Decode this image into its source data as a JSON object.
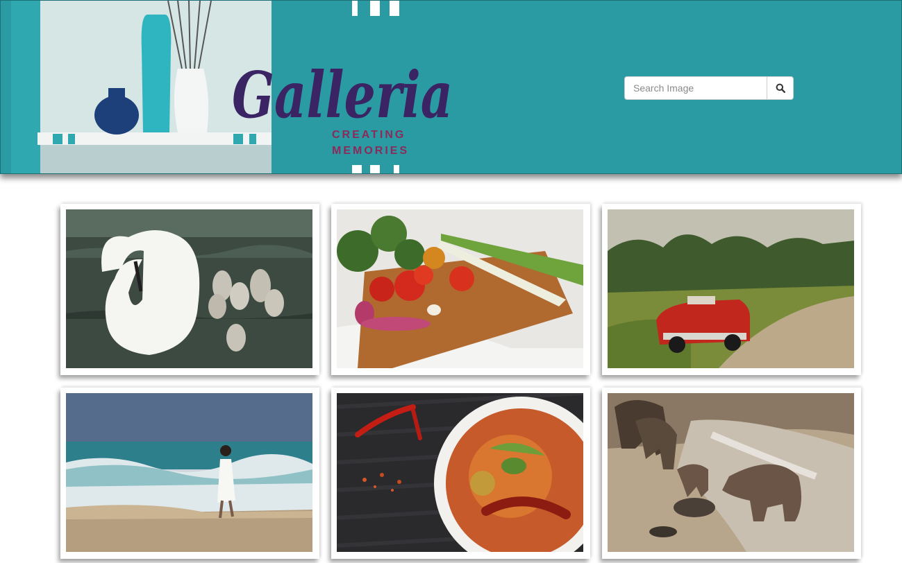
{
  "brand": {
    "logo_text": "Galleria",
    "tagline_line1": "CREATING",
    "tagline_line2": "MEMORIES"
  },
  "search": {
    "placeholder": "Search Image",
    "value": "",
    "icon": "search-icon"
  },
  "gallery": {
    "images": [
      {
        "subject": "swan-with-cygnets"
      },
      {
        "subject": "vegetables-on-cutting-board"
      },
      {
        "subject": "red-vintage-convertible"
      },
      {
        "subject": "woman-on-beach-waves"
      },
      {
        "subject": "curry-bowl-with-chilies"
      },
      {
        "subject": "elephants-in-river"
      }
    ]
  },
  "colors": {
    "header_bg": "#2a9aa3",
    "logo_purple": "#3a2463",
    "tagline_magenta": "#8c2a5a"
  }
}
